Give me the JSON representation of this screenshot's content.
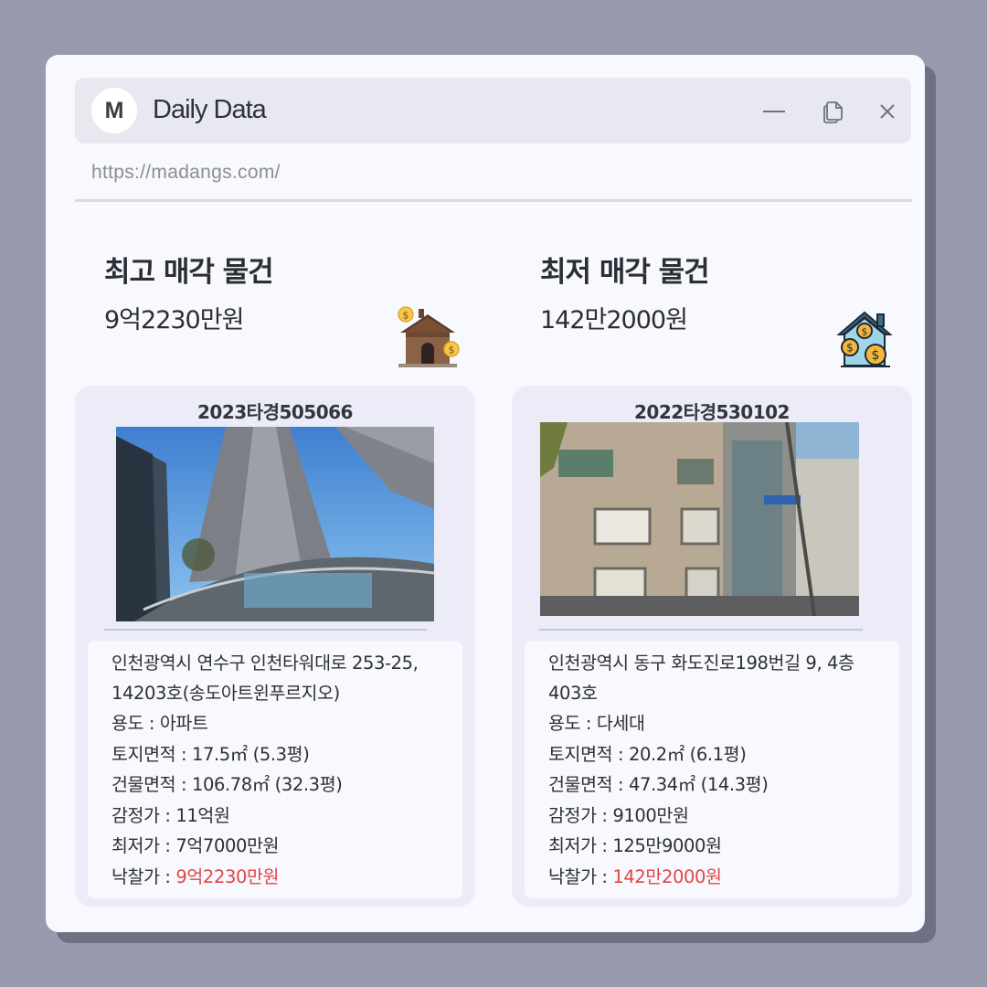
{
  "app": {
    "logo_letter": "M",
    "title": "Daily Data",
    "url": "https://madangs.com/"
  },
  "controls": {
    "minimize": "minimize-icon",
    "copy": "copy-icon",
    "close": "close-icon"
  },
  "highest": {
    "heading": "최고 매각 물건",
    "price": "9억2230만원",
    "icon": "house-coins-icon",
    "case_no": "2023타경505066",
    "address": "인천광역시 연수구 인천타워대로 253-25, 14203호(송도아트윈푸르지오)",
    "rows": [
      {
        "label": "용도 : ",
        "value": "아파트"
      },
      {
        "label": "토지면적 : ",
        "value": "17.5㎡ (5.3평)"
      },
      {
        "label": "건물면적 : ",
        "value": "106.78㎡ (32.3평)"
      },
      {
        "label": "감정가 : ",
        "value": "11억원"
      },
      {
        "label": "최저가 : ",
        "value": "7억7000만원"
      }
    ],
    "sale_label": "낙찰가 : ",
    "sale_value": "9억2230만원"
  },
  "lowest": {
    "heading": "최저 매각 물건",
    "price": "142만2000원",
    "icon": "house-dollar-icon",
    "case_no": "2022타경530102",
    "address": "인천광역시 동구 화도진로198번길 9, 4층403호",
    "rows": [
      {
        "label": "용도 : ",
        "value": "다세대"
      },
      {
        "label": "토지면적 : ",
        "value": "20.2㎡ (6.1평)"
      },
      {
        "label": "건물면적 : ",
        "value": "47.34㎡ (14.3평)"
      },
      {
        "label": "감정가 : ",
        "value": "9100만원"
      },
      {
        "label": "최저가 : ",
        "value": "125만9000원"
      }
    ],
    "sale_label": "낙찰가 : ",
    "sale_value": "142만2000원"
  },
  "colors": {
    "background": "#989aae",
    "window": "#f8f9fe",
    "card": "#ebecf8",
    "accent_red": "#e24646"
  }
}
